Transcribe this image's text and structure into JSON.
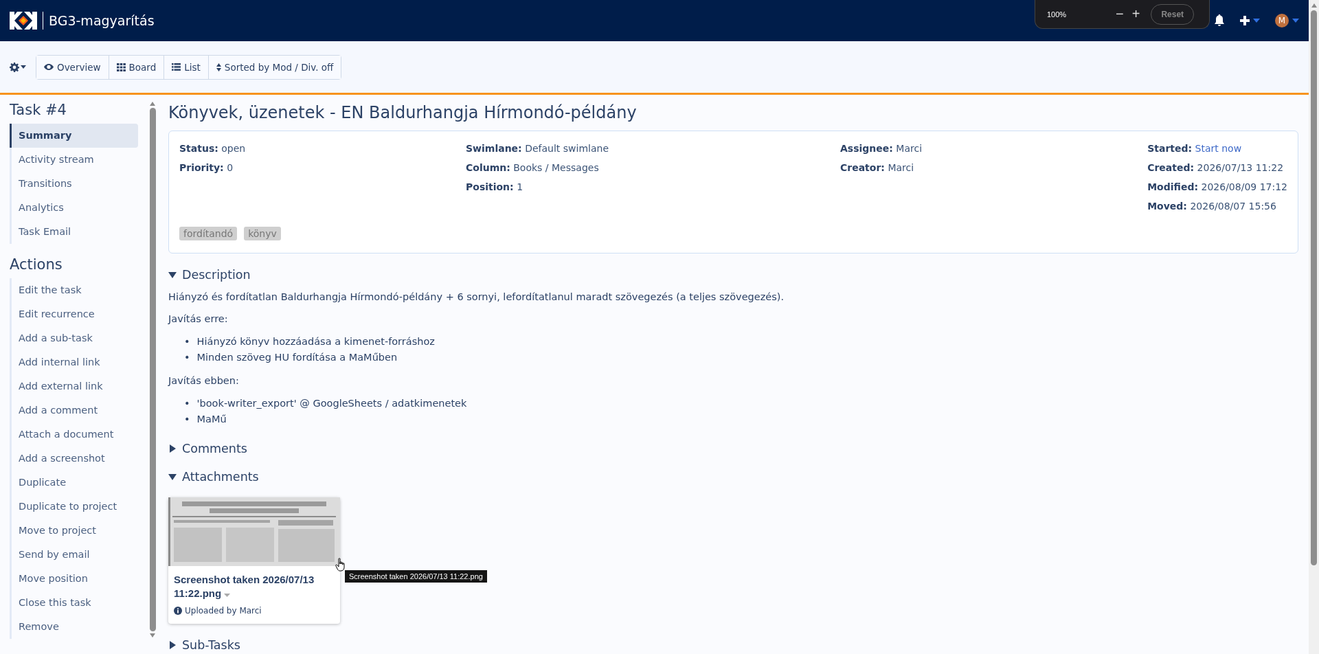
{
  "header": {
    "project": "BG3-magyarítás"
  },
  "zoom_popup": {
    "level": "100%",
    "minus": "−",
    "plus": "+",
    "reset": "Reset"
  },
  "user": {
    "initial": "M"
  },
  "toolbar": {
    "views": [
      {
        "label": "Overview"
      },
      {
        "label": "Board"
      },
      {
        "label": "List"
      },
      {
        "label": "Sorted by Mod / Div. off"
      }
    ]
  },
  "sidebar": {
    "task_title": "Task #4",
    "items": [
      {
        "label": "Summary",
        "selected": true
      },
      {
        "label": "Activity stream",
        "selected": false
      },
      {
        "label": "Transitions",
        "selected": false
      },
      {
        "label": "Analytics",
        "selected": false
      },
      {
        "label": "Task Email",
        "selected": false
      }
    ],
    "actions_title": "Actions",
    "actions": [
      "Edit the task",
      "Edit recurrence",
      "Add a sub-task",
      "Add internal link",
      "Add external link",
      "Add a comment",
      "Attach a document",
      "Add a screenshot",
      "Duplicate",
      "Duplicate to project",
      "Move to project",
      "Send by email",
      "Move position",
      "Close this task",
      "Remove"
    ]
  },
  "task": {
    "title": "Könyvek, üzenetek - EN Baldurhangja Hírmondó-példány",
    "columns": [
      [
        {
          "label": "Status:",
          "value": "open",
          "kind": "text"
        },
        {
          "label": "Priority:",
          "value": "0",
          "kind": "text"
        }
      ],
      [
        {
          "label": "Swimlane:",
          "value": "Default swimlane",
          "kind": "text"
        },
        {
          "label": "Column:",
          "value": "Books / Messages",
          "kind": "text"
        },
        {
          "label": "Position:",
          "value": "1",
          "kind": "text"
        }
      ],
      [
        {
          "label": "Assignee:",
          "value": "Marci",
          "kind": "text"
        },
        {
          "label": "Creator:",
          "value": "Marci",
          "kind": "text"
        }
      ],
      [
        {
          "label": "Started:",
          "value": "Start now",
          "kind": "link"
        },
        {
          "label": "Created:",
          "value": "2026/07/13 11:22",
          "kind": "text"
        },
        {
          "label": "Modified:",
          "value": "2026/08/09 17:12",
          "kind": "text"
        },
        {
          "label": "Moved:",
          "value": "2026/08/07 15:56",
          "kind": "text"
        }
      ]
    ],
    "tags": [
      "fordítandó",
      "könyv"
    ]
  },
  "sections": [
    {
      "title": "Description",
      "expanded": true,
      "blocks": [
        {
          "kind": "paragraph",
          "text": "Hiányzó és fordítatlan Baldurhangja Hírmondó-példány + 6 sornyi, lefordítatlanul maradt szövegezés (a teljes szövegezés)."
        },
        {
          "kind": "paragraph",
          "text": "Javítás erre:"
        },
        {
          "kind": "list",
          "marker": "•",
          "items": [
            "Hiányzó könyv hozzáadása a kimenet-forráshoz",
            "Minden szöveg HU fordítása a MaMűben"
          ]
        },
        {
          "kind": "paragraph",
          "text": "Javítás ebben:"
        },
        {
          "kind": "list",
          "marker": "•",
          "items": [
            "'book-writer_export' @ GoogleSheets / adatkimenetek",
            "MaMű"
          ]
        }
      ]
    },
    {
      "title": "Comments",
      "expanded": false
    },
    {
      "title": "Attachments",
      "expanded": true,
      "attachments": [
        {
          "kind": "picture",
          "name": "Screenshot taken 2026/07/13 11:22.png",
          "uploader": "Uploaded by Marci",
          "tooltip": "Screenshot taken 2026/07/13 11:22.png"
        }
      ]
    },
    {
      "title": "Sub-Tasks",
      "expanded": false
    }
  ]
}
